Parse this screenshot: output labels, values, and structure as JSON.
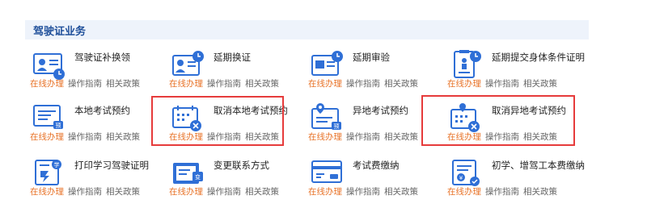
{
  "section": {
    "title": "驾驶证业务"
  },
  "links": {
    "online": "在线办理",
    "guide": "操作指南",
    "policy": "相关政策"
  },
  "items": [
    {
      "title": "驾驶证补换领",
      "icon": "license-card-icon"
    },
    {
      "title": "延期换证",
      "icon": "license-renew-icon"
    },
    {
      "title": "延期审验",
      "icon": "review-delay-icon"
    },
    {
      "title": "延期提交身体条件证明",
      "icon": "health-certificate-icon"
    },
    {
      "title": "本地考试预约",
      "icon": "local-exam-icon"
    },
    {
      "title": "取消本地考试预约",
      "icon": "cancel-local-exam-icon"
    },
    {
      "title": "异地考试预约",
      "icon": "remote-exam-icon"
    },
    {
      "title": "取消异地考试预约",
      "icon": "cancel-remote-exam-icon"
    },
    {
      "title": "打印学习驾驶证明",
      "icon": "print-learner-icon"
    },
    {
      "title": "变更联系方式",
      "icon": "change-contact-icon"
    },
    {
      "title": "考试费缴纳",
      "icon": "exam-fee-icon"
    },
    {
      "title": "初学、增驾工本费缴纳",
      "icon": "cost-fee-icon"
    }
  ],
  "colors": {
    "accent": "#2f6fd6",
    "online": "#e8742a",
    "highlight": "#e63b3b",
    "header_bg": "#eef3fb"
  }
}
